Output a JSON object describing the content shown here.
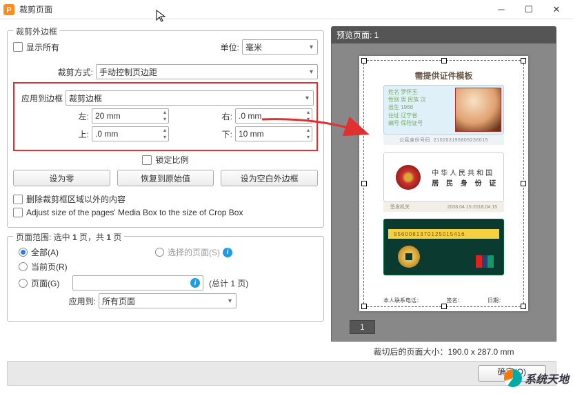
{
  "window": {
    "title": "裁剪页面"
  },
  "crop": {
    "group_title": "裁剪外边框",
    "show_all_label": "显示所有",
    "unit_label": "单位:",
    "unit_value": "毫米",
    "method_label": "裁剪方式:",
    "method_value": "手动控制页边距",
    "apply_box_label": "应用到边框",
    "apply_box_value": "裁剪边框",
    "left_label": "左:",
    "left_value": "20 mm",
    "right_label": "右:",
    "right_value": ".0 mm",
    "top_label": "上:",
    "top_value": ".0 mm",
    "bottom_label": "下:",
    "bottom_value": "10 mm",
    "lock_ratio_label": "锁定比例",
    "btn_zero": "设为零",
    "btn_reset": "恢复到原始值",
    "btn_blank": "设为空白外边框",
    "remove_outside_label": "删除裁剪框区域以外的内容",
    "adjust_media_label": "Adjust size of the pages' Media Box to the size of Crop Box"
  },
  "range": {
    "prefix": "页面范围: 选中 ",
    "sel": "1",
    "mid": " 页，共 ",
    "tot": "1",
    "suffix": " 页",
    "all_label": "全部(A)",
    "selected_label": "选择的页面(S)",
    "current_label": "当前页(R)",
    "page_label": "页面(G)",
    "total_label": "(总计 1 页)",
    "apply_to_label": "应用到:",
    "apply_to_value": "所有页面"
  },
  "preview": {
    "header": "预览页面: 1",
    "doc_title": "需提供证件模板",
    "id_num": "210203196809236015",
    "cn_line1": "中华人民共和国",
    "cn_line2": "居 民 身 份 证",
    "validity": "2008.04.15-2018.04.15",
    "bank_num": "9560081370125015416",
    "sig_contact": "本人联系电话：",
    "sig_sign": "签名：",
    "sig_date": "日期：",
    "page_tab": "1",
    "cropped_size": "裁切后的页面大小：190.0 x 287.0 mm"
  },
  "footer": {
    "ok": "确定(O)"
  },
  "watermark": {
    "text": "系统天地"
  }
}
